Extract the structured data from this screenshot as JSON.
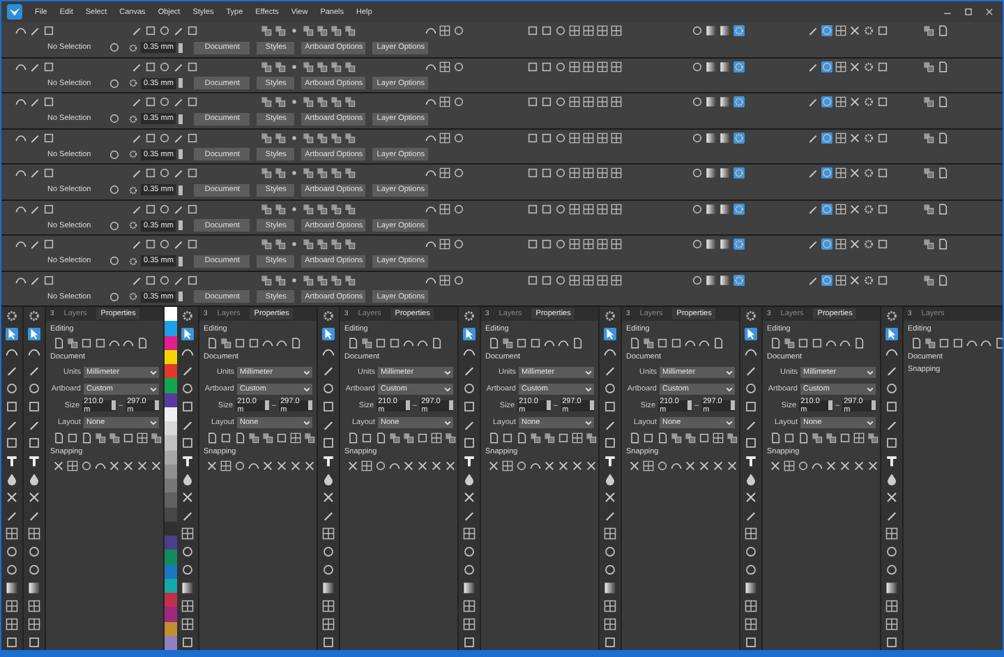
{
  "menu": [
    "File",
    "Edit",
    "Select",
    "Canvas",
    "Object",
    "Styles",
    "Type",
    "Effects",
    "View",
    "Panels",
    "Help"
  ],
  "toolbars": [
    {
      "selection": "No Selection",
      "stroke": "0.35 mm",
      "buttons": [
        "Document",
        "Styles",
        "Artboard Options",
        "Layer Options"
      ]
    },
    {
      "selection": "No Selection",
      "stroke": "0.35 mm",
      "buttons": [
        "Document",
        "Styles",
        "Artboard Options",
        "Layer Options"
      ]
    },
    {
      "selection": "No Selection",
      "stroke": "0.35 mm",
      "buttons": [
        "Document",
        "Styles",
        "Artboard Options",
        "Layer Options"
      ]
    },
    {
      "selection": "No Selection",
      "stroke": "0.35 mm",
      "buttons": [
        "Document",
        "Styles",
        "Artboard Options",
        "Layer Options"
      ]
    },
    {
      "selection": "No Selection",
      "stroke": "0.35 mm",
      "buttons": [
        "Document",
        "Styles",
        "Artboard Options",
        "Layer Options"
      ]
    },
    {
      "selection": "No Selection",
      "stroke": "0.35 mm",
      "buttons": [
        "Document",
        "Styles",
        "Artboard Options",
        "Layer Options"
      ]
    },
    {
      "selection": "No Selection",
      "stroke": "0.35 mm",
      "buttons": [
        "Document",
        "Styles",
        "Artboard Options",
        "Layer Options"
      ]
    },
    {
      "selection": "No Selection",
      "stroke": "0.35 mm",
      "buttons": [
        "Document",
        "Styles",
        "Artboard Options",
        "Layer Options"
      ]
    }
  ],
  "mode_buttons": [
    {
      "selected": false
    },
    {
      "selected": false
    },
    {
      "selected": false
    },
    {
      "selected": true
    }
  ],
  "snap_buttons": [
    {
      "selected": false
    },
    {
      "selected": true
    },
    {
      "selected": false
    },
    {
      "selected": false
    },
    {
      "selected": false
    },
    {
      "selected": false
    }
  ],
  "tools": [
    {
      "selected": true
    },
    {
      "selected": false
    },
    {
      "selected": false
    },
    {
      "selected": false
    },
    {
      "selected": false
    },
    {
      "selected": false
    },
    {
      "selected": false
    },
    {
      "selected": false
    },
    {
      "selected": false
    },
    {
      "selected": false
    },
    {
      "selected": false
    },
    {
      "selected": false
    },
    {
      "selected": false
    },
    {
      "selected": false
    },
    {
      "selected": false
    },
    {
      "selected": false
    },
    {
      "selected": false
    },
    {
      "selected": false
    }
  ],
  "swatches": [
    {
      "color": "#ffffff"
    },
    {
      "color": "#1fa0e6"
    },
    {
      "color": "#e0208c"
    },
    {
      "color": "#f2d500"
    },
    {
      "color": "#e03a2a"
    },
    {
      "color": "#13a44f"
    },
    {
      "color": "#5a3a9c"
    },
    {
      "color": "#f0f0f0"
    },
    {
      "color": "#d8d8d8"
    },
    {
      "color": "#c0c0c0"
    },
    {
      "color": "#a8a8a8"
    },
    {
      "color": "#909090"
    },
    {
      "color": "#787878"
    },
    {
      "color": "#606060"
    },
    {
      "color": "#484848"
    },
    {
      "color": "#303030"
    },
    {
      "color": "#4a3f8a"
    },
    {
      "color": "#128c5a"
    },
    {
      "color": "#1a78c0"
    },
    {
      "color": "#14a8a8"
    },
    {
      "color": "#c0304a"
    },
    {
      "color": "#a02880"
    },
    {
      "color": "#c09030"
    },
    {
      "color": "#9080c0"
    }
  ],
  "panels": [
    {
      "tab_count": "3",
      "tabs": [
        {
          "label": "Layers",
          "selected": false
        },
        {
          "label": "Properties",
          "selected": true
        }
      ],
      "editing": "Editing",
      "document": "Document",
      "snapping": "Snapping",
      "fields": [
        {
          "kind": "dropdown",
          "label": "Units",
          "value": "Millimeter"
        },
        {
          "kind": "dropdown",
          "label": "Artboard",
          "value": "Custom"
        },
        {
          "kind": "size",
          "label": "Size",
          "values": [
            "210.0 m",
            "297.0 m"
          ],
          "separator": "–"
        },
        {
          "kind": "dropdown",
          "label": "Layout",
          "value": "None"
        }
      ]
    },
    {
      "tab_count": "3",
      "tabs": [
        {
          "label": "Layers",
          "selected": false
        },
        {
          "label": "Properties",
          "selected": true
        }
      ],
      "editing": "Editing",
      "document": "Document",
      "snapping": "Snapping",
      "fields": [
        {
          "kind": "dropdown",
          "label": "Units",
          "value": "Millimeter"
        },
        {
          "kind": "dropdown",
          "label": "Artboard",
          "value": "Custom"
        },
        {
          "kind": "size",
          "label": "Size",
          "values": [
            "210.0 m",
            "297.0 m"
          ],
          "separator": "–"
        },
        {
          "kind": "dropdown",
          "label": "Layout",
          "value": "None"
        }
      ]
    },
    {
      "tab_count": "3",
      "tabs": [
        {
          "label": "Layers",
          "selected": false
        },
        {
          "label": "Properties",
          "selected": true
        }
      ],
      "editing": "Editing",
      "document": "Document",
      "snapping": "Snapping",
      "fields": [
        {
          "kind": "dropdown",
          "label": "Units",
          "value": "Millimeter"
        },
        {
          "kind": "dropdown",
          "label": "Artboard",
          "value": "Custom"
        },
        {
          "kind": "size",
          "label": "Size",
          "values": [
            "210.0 m",
            "297.0 m"
          ],
          "separator": "–"
        },
        {
          "kind": "dropdown",
          "label": "Layout",
          "value": "None"
        }
      ]
    },
    {
      "tab_count": "3",
      "tabs": [
        {
          "label": "Layers",
          "selected": false
        },
        {
          "label": "Properties",
          "selected": true
        }
      ],
      "editing": "Editing",
      "document": "Document",
      "snapping": "Snapping",
      "fields": [
        {
          "kind": "dropdown",
          "label": "Units",
          "value": "Millimeter"
        },
        {
          "kind": "dropdown",
          "label": "Artboard",
          "value": "Custom"
        },
        {
          "kind": "size",
          "label": "Size",
          "values": [
            "210.0 m",
            "297.0 m"
          ],
          "separator": "–"
        },
        {
          "kind": "dropdown",
          "label": "Layout",
          "value": "None"
        }
      ]
    },
    {
      "tab_count": "3",
      "tabs": [
        {
          "label": "Layers",
          "selected": false
        },
        {
          "label": "Properties",
          "selected": true
        }
      ],
      "editing": "Editing",
      "document": "Document",
      "snapping": "Snapping",
      "fields": [
        {
          "kind": "dropdown",
          "label": "Units",
          "value": "Millimeter"
        },
        {
          "kind": "dropdown",
          "label": "Artboard",
          "value": "Custom"
        },
        {
          "kind": "size",
          "label": "Size",
          "values": [
            "210.0 m",
            "297.0 m"
          ],
          "separator": "–"
        },
        {
          "kind": "dropdown",
          "label": "Layout",
          "value": "None"
        }
      ]
    },
    {
      "tab_count": "3",
      "tabs": [
        {
          "label": "Layers",
          "selected": false
        },
        {
          "label": "Properties",
          "selected": true
        }
      ],
      "editing": "Editing",
      "document": "Document",
      "snapping": "Snapping",
      "fields": [
        {
          "kind": "dropdown",
          "label": "Units",
          "value": "Millimeter"
        },
        {
          "kind": "dropdown",
          "label": "Artboard",
          "value": "Custom"
        },
        {
          "kind": "size",
          "label": "Size",
          "values": [
            "210.0 m",
            "297.0 m"
          ],
          "separator": "–"
        },
        {
          "kind": "dropdown",
          "label": "Layout",
          "value": "None"
        }
      ]
    },
    {
      "tab_count": "3",
      "tabs": [
        {
          "label": "Layers",
          "selected": false
        }
      ],
      "editing": "Editing",
      "document": "Document",
      "snapping": "Snapping"
    }
  ]
}
